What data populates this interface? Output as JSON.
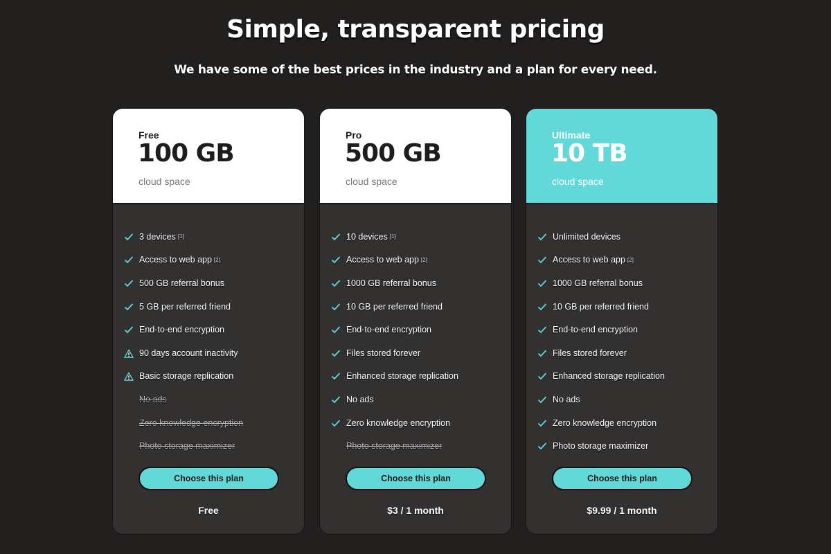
{
  "header": {
    "title": "Simple, transparent pricing",
    "subtitle": "We have some of the best prices in the industry and a plan for every need."
  },
  "colors": {
    "accent": "#63d8d8",
    "background": "#221f1f",
    "card": "#333030"
  },
  "plans": [
    {
      "name": "Free",
      "size": "100 GB",
      "sub": "cloud space",
      "price": "Free",
      "button": "Choose this plan",
      "features": [
        {
          "text": "3 devices",
          "note": "[1]",
          "status": "check"
        },
        {
          "text": "Access to web app",
          "note": "[2]",
          "status": "check"
        },
        {
          "text": "500 GB referral bonus",
          "note": "",
          "status": "check"
        },
        {
          "text": "5 GB per referred friend",
          "note": "",
          "status": "check"
        },
        {
          "text": "End-to-end encryption",
          "note": "",
          "status": "check"
        },
        {
          "text": "90 days account inactivity",
          "note": "",
          "status": "warning"
        },
        {
          "text": "Basic storage replication",
          "note": "",
          "status": "warning"
        },
        {
          "text": "No ads",
          "note": "",
          "status": "unavailable"
        },
        {
          "text": "Zero knowledge encryption",
          "note": "",
          "status": "unavailable"
        },
        {
          "text": "Photo storage maximizer",
          "note": "",
          "status": "unavailable"
        }
      ]
    },
    {
      "name": "Pro",
      "size": "500 GB",
      "sub": "cloud space",
      "price": "$3 / 1 month",
      "button": "Choose this plan",
      "features": [
        {
          "text": "10 devices",
          "note": "[1]",
          "status": "check"
        },
        {
          "text": "Access to web app",
          "note": "[2]",
          "status": "check"
        },
        {
          "text": "1000 GB referral bonus",
          "note": "",
          "status": "check"
        },
        {
          "text": "10 GB per referred friend",
          "note": "",
          "status": "check"
        },
        {
          "text": "End-to-end encryption",
          "note": "",
          "status": "check"
        },
        {
          "text": "Files stored forever",
          "note": "",
          "status": "check"
        },
        {
          "text": "Enhanced storage replication",
          "note": "",
          "status": "check"
        },
        {
          "text": "No ads",
          "note": "",
          "status": "check"
        },
        {
          "text": "Zero knowledge encryption",
          "note": "",
          "status": "check"
        },
        {
          "text": "Photo storage maximizer",
          "note": "",
          "status": "unavailable"
        }
      ]
    },
    {
      "name": "Ultimate",
      "size": "10 TB",
      "sub": "cloud space",
      "price": "$9.99 / 1 month",
      "button": "Choose this plan",
      "features": [
        {
          "text": "Unlimited devices",
          "note": "",
          "status": "check"
        },
        {
          "text": "Access to web app",
          "note": "[2]",
          "status": "check"
        },
        {
          "text": "1000 GB referral bonus",
          "note": "",
          "status": "check"
        },
        {
          "text": "10 GB per referred friend",
          "note": "",
          "status": "check"
        },
        {
          "text": "End-to-end encryption",
          "note": "",
          "status": "check"
        },
        {
          "text": "Files stored forever",
          "note": "",
          "status": "check"
        },
        {
          "text": "Enhanced storage replication",
          "note": "",
          "status": "check"
        },
        {
          "text": "No ads",
          "note": "",
          "status": "check"
        },
        {
          "text": "Zero knowledge encryption",
          "note": "",
          "status": "check"
        },
        {
          "text": "Photo storage maximizer",
          "note": "",
          "status": "check"
        }
      ]
    }
  ]
}
